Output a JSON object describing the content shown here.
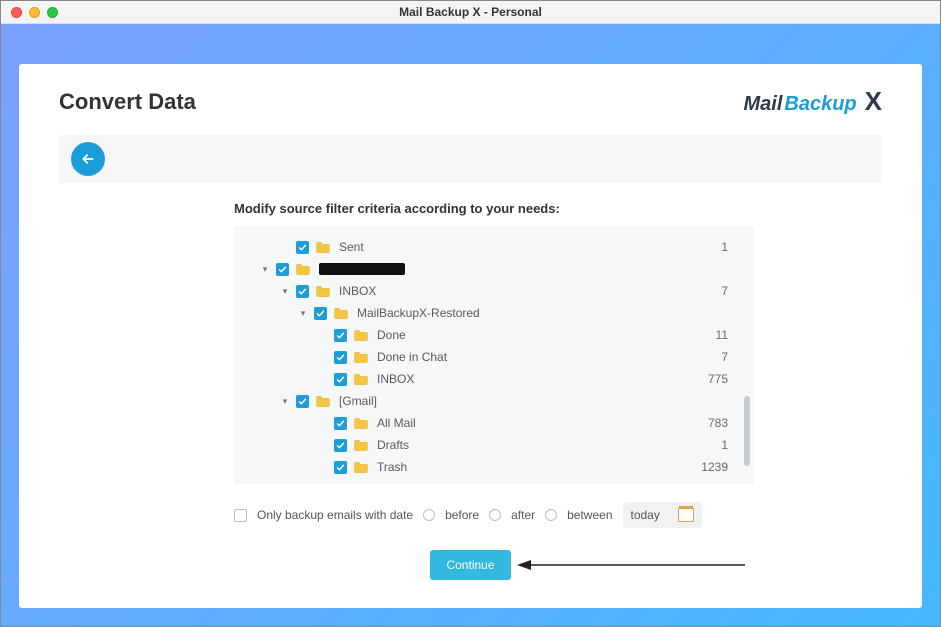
{
  "window": {
    "title": "Mail Backup X - Personal"
  },
  "page": {
    "title": "Convert Data"
  },
  "logo": {
    "part1": "Mail",
    "part2": "Backup",
    "part3": "X"
  },
  "instructions": "Modify source filter criteria according to your needs:",
  "tree": [
    {
      "indent": 0,
      "expander": "",
      "checked": true,
      "icon": "folder",
      "label": "Sent",
      "count": "1"
    },
    {
      "indent": 1,
      "expander": "▾",
      "checked": true,
      "icon": "folder",
      "label": "",
      "redacted": true,
      "count": ""
    },
    {
      "indent": 2,
      "expander": "▾",
      "checked": true,
      "icon": "folder",
      "label": "INBOX",
      "count": "7"
    },
    {
      "indent": 3,
      "expander": "▾",
      "checked": true,
      "icon": "folder",
      "label": "MailBackupX-Restored",
      "count": ""
    },
    {
      "indent": 4,
      "expander": "",
      "checked": true,
      "icon": "folder",
      "label": "Done",
      "count": "11"
    },
    {
      "indent": 4,
      "expander": "",
      "checked": true,
      "icon": "folder",
      "label": "Done in Chat",
      "count": "7"
    },
    {
      "indent": 4,
      "expander": "",
      "checked": true,
      "icon": "folder",
      "label": "INBOX",
      "count": "775"
    },
    {
      "indent": 2,
      "expander": "▾",
      "checked": true,
      "icon": "folder",
      "label": "[Gmail]",
      "count": ""
    },
    {
      "indent": 4,
      "expander": "",
      "checked": true,
      "icon": "folder",
      "label": "All Mail",
      "count": "783"
    },
    {
      "indent": 4,
      "expander": "",
      "checked": true,
      "icon": "folder",
      "label": "Drafts",
      "count": "1"
    },
    {
      "indent": 4,
      "expander": "",
      "checked": true,
      "icon": "folder",
      "label": "Trash",
      "count": "1239"
    }
  ],
  "filter": {
    "only_backup_label": "Only backup emails with date",
    "before": "before",
    "after": "after",
    "between": "between",
    "date_value": "today"
  },
  "buttons": {
    "continue": "Continue"
  }
}
